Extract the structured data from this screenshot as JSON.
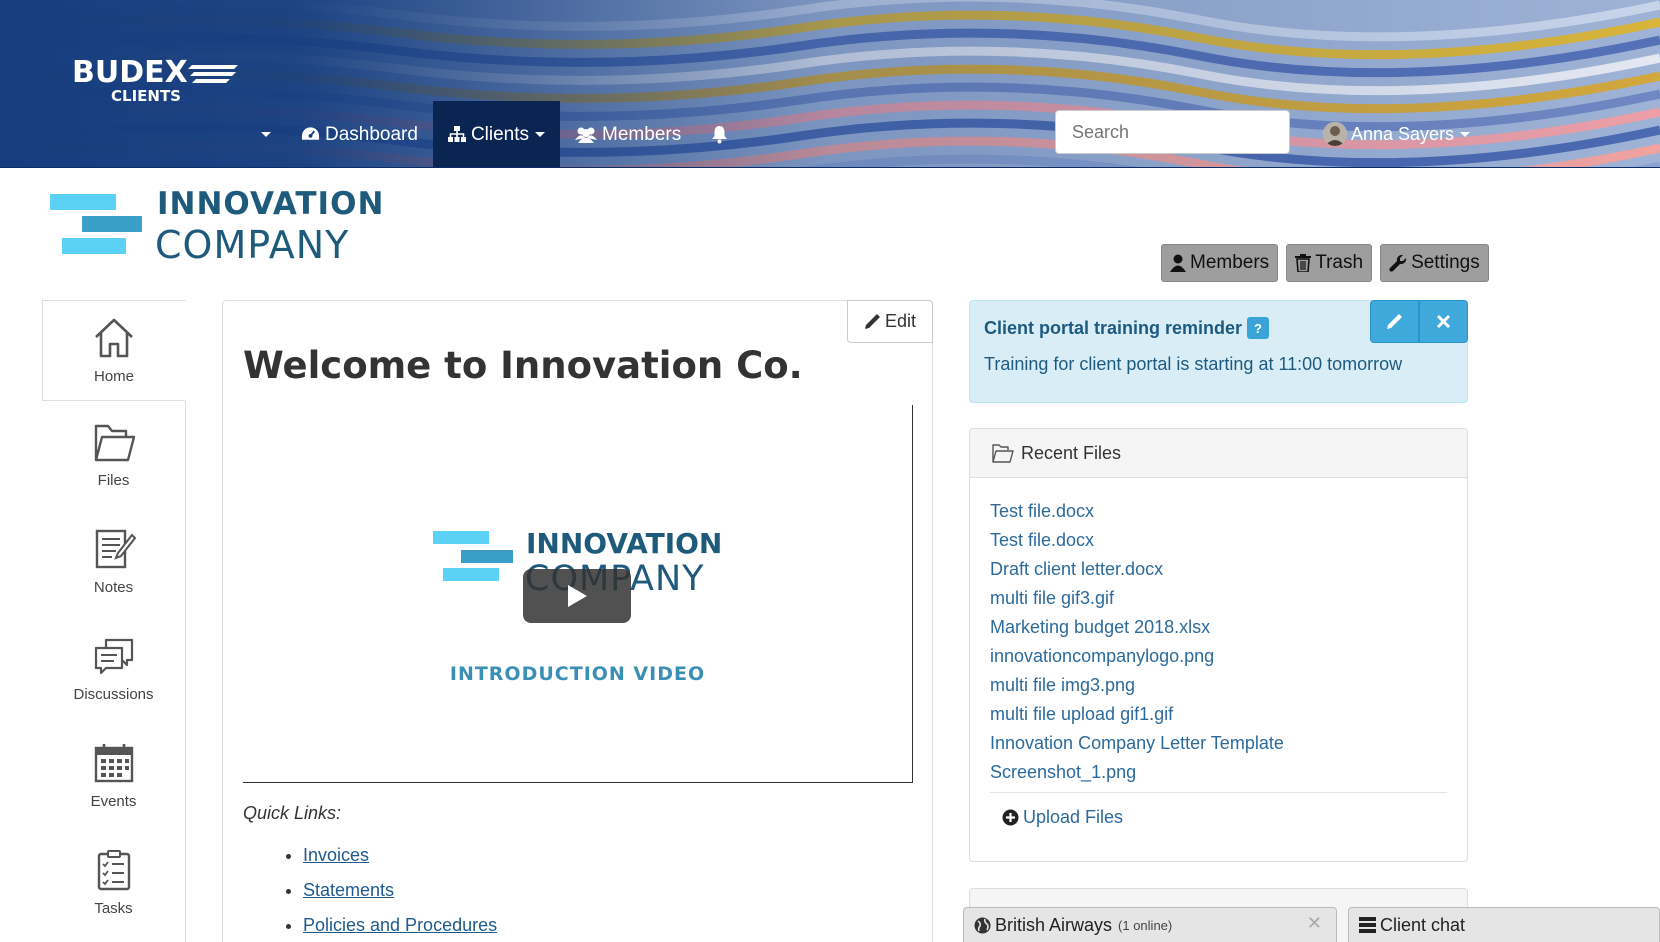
{
  "header": {
    "brand_main": "BUDEX",
    "brand_sub": "CLIENTS",
    "nav": {
      "dashboard": "Dashboard",
      "clients": "Clients",
      "members": "Members"
    },
    "search_placeholder": "Search",
    "user_name": "Anna Sayers"
  },
  "company": {
    "line1": "INNOVATION",
    "line2": "COMPANY"
  },
  "top_buttons": {
    "members": "Members",
    "trash": "Trash",
    "settings": "Settings"
  },
  "sidebar": {
    "items": [
      {
        "label": "Home",
        "icon": "home-icon"
      },
      {
        "label": "Files",
        "icon": "folder-icon"
      },
      {
        "label": "Notes",
        "icon": "notes-icon"
      },
      {
        "label": "Discussions",
        "icon": "discussions-icon"
      },
      {
        "label": "Events",
        "icon": "calendar-icon"
      },
      {
        "label": "Tasks",
        "icon": "tasks-icon"
      }
    ]
  },
  "main": {
    "edit_label": "Edit",
    "title": "Welcome to Innovation Co.",
    "video": {
      "logo_line1": "INNOVATION",
      "logo_line2": "COMPANY",
      "caption": "INTRODUCTION VIDEO"
    },
    "quick_links_label": "Quick Links:",
    "quick_links": [
      "Invoices",
      "Statements",
      "Policies and Procedures"
    ]
  },
  "notice": {
    "title": "Client portal training reminder",
    "help": "?",
    "text": "Training for client portal is starting at 11:00 tomorrow"
  },
  "recent_files": {
    "title": "Recent Files",
    "files": [
      "Test file.docx",
      "Test file.docx",
      "Draft client letter.docx",
      "multi file gif3.gif",
      "Marketing budget 2018.xlsx",
      "innovationcompanylogo.png",
      "multi file img3.png",
      "multi file upload gif1.gif",
      "Innovation Company Letter Template",
      "Screenshot_1.png"
    ],
    "upload_label": "Upload Files"
  },
  "chat": {
    "group_name": "British Airways",
    "group_status": "(1 online)",
    "client_chat": "Client chat"
  },
  "colors": {
    "header_bg": "#163d7e",
    "nav_active": "#0b2553",
    "link": "#2c6a9c",
    "notice_bg": "#d9edf7",
    "notice_btn": "#3fa9db",
    "logo_dark": "#1e5a7c",
    "logo_light": "#5bd1f5"
  }
}
